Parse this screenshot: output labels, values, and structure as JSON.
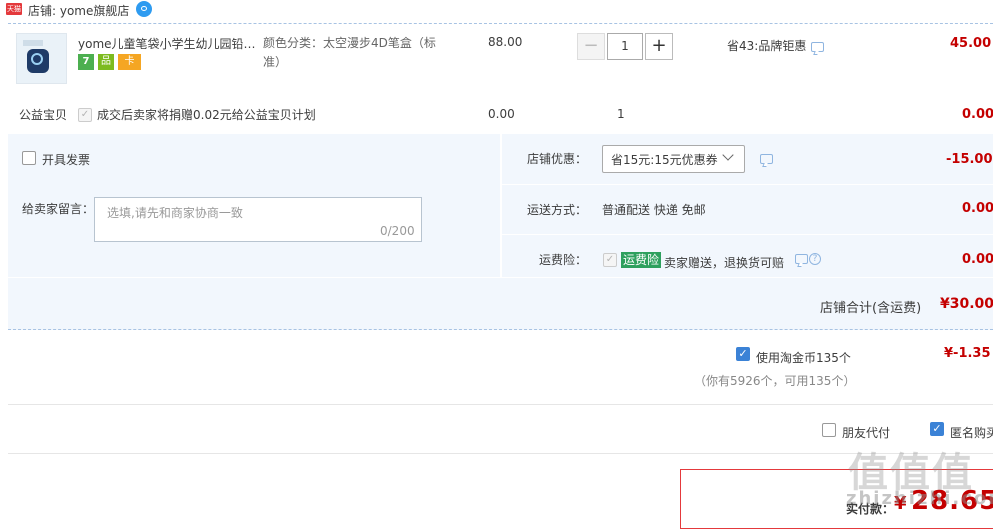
{
  "shop": {
    "platform_badge": "天猫",
    "name": "店铺: yome旗舰店"
  },
  "item": {
    "title": "yome儿童笔袋小学生幼儿园铅笔盒",
    "badges": {
      "seven_day": "7",
      "quality": "品",
      "card": "卡"
    },
    "sku": "颜色分类：太空漫步4D笔盒（标准）",
    "price": "88.00",
    "qty_minus": "−",
    "qty": "1",
    "qty_plus": "+",
    "saving": "省43:品牌钜惠",
    "total": "45.00"
  },
  "charity": {
    "label": "公益宝贝",
    "text": "成交后卖家将捐赠0.02元给公益宝贝计划",
    "price": "0.00",
    "qty": "1",
    "total": "0.00"
  },
  "invoice": {
    "label": "开具发票"
  },
  "message": {
    "label": "给卖家留言：",
    "placeholder": "选填,请先和商家协商一致",
    "count": "0/200"
  },
  "shop_discount": {
    "label": "店铺优惠：",
    "selected": "省15元:15元优惠券",
    "total": "-15.00"
  },
  "shipping": {
    "label": "运送方式：",
    "value": "普通配送 快递 免邮",
    "total": "0.00"
  },
  "insurance": {
    "label": "运费险：",
    "badge": "运费险",
    "text": "卖家赠送，退换货可赔",
    "help": "?",
    "total": "0.00"
  },
  "subtotal": {
    "label": "店铺合计(含运费)",
    "value": "¥30.00"
  },
  "coins": {
    "label": "使用淘金币135个",
    "sub": "（你有5926个，可用135个）",
    "value": "¥-1.35"
  },
  "options": {
    "friend_pay": "朋友代付",
    "anonymous": "匿名购买"
  },
  "payment": {
    "label": "实付款：",
    "currency": "¥",
    "amount": "28.65"
  },
  "watermark": {
    "big": "值值值",
    "small": "zhizhizhi.com"
  }
}
